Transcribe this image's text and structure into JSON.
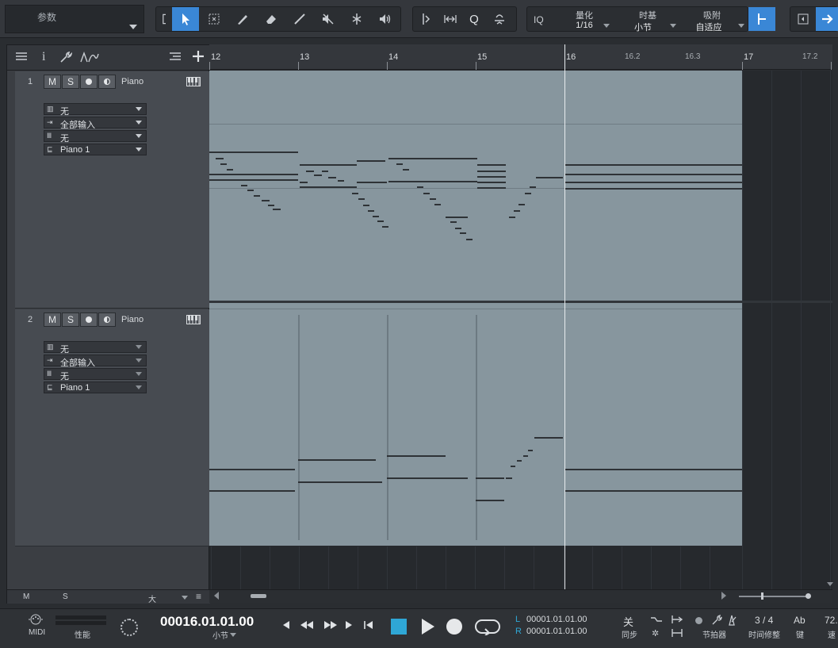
{
  "toolbar": {
    "param_label": "参数",
    "quantize": {
      "label": "量化",
      "value": "1/16"
    },
    "timebase": {
      "label": "时基",
      "value": "小节"
    },
    "snap": {
      "label": "吸附",
      "value": "自适应"
    },
    "iq": "IQ",
    "quantize_button": "Q"
  },
  "ruler": {
    "bars": [
      "12",
      "13",
      "14",
      "15",
      "16",
      "16.2",
      "16.3",
      "17",
      "17.2"
    ]
  },
  "tracks": [
    {
      "number": "1",
      "mute": "M",
      "solo": "S",
      "name": "Piano",
      "io": [
        {
          "icon": "keyboard",
          "value": "无"
        },
        {
          "icon": "input",
          "value": "全部输入"
        },
        {
          "icon": "bars",
          "value": "无"
        },
        {
          "icon": "instrument",
          "value": "Piano 1"
        }
      ]
    },
    {
      "number": "2",
      "mute": "M",
      "solo": "S",
      "name": "Piano",
      "io": [
        {
          "icon": "keyboard",
          "value": "无"
        },
        {
          "icon": "input",
          "value": "全部输入"
        },
        {
          "icon": "bars",
          "value": "无"
        },
        {
          "icon": "instrument",
          "value": "Piano 1"
        }
      ]
    }
  ],
  "panel_footer": {
    "m": "M",
    "s": "S",
    "size": "大"
  },
  "transport": {
    "midi_label": "MIDI",
    "perf_label": "性能",
    "position": "00016.01.01.00",
    "position_unit": "小节",
    "left_locator_label": "L",
    "left_locator": "00001.01.01.00",
    "right_locator_label": "R",
    "right_locator": "00001.01.01.00",
    "sync_state": "关",
    "sync_label": "同步",
    "metronome_label": "节拍器",
    "time_signature": "3 / 4",
    "time_sig_label": "时间修整",
    "key_value": "Ab",
    "key_label": "键",
    "tempo_value": "72.",
    "tempo_label": "速"
  },
  "colors": {
    "accent": "#3a87d6",
    "transport_stop": "#2fa7d6",
    "event_bg": "#87969e"
  }
}
